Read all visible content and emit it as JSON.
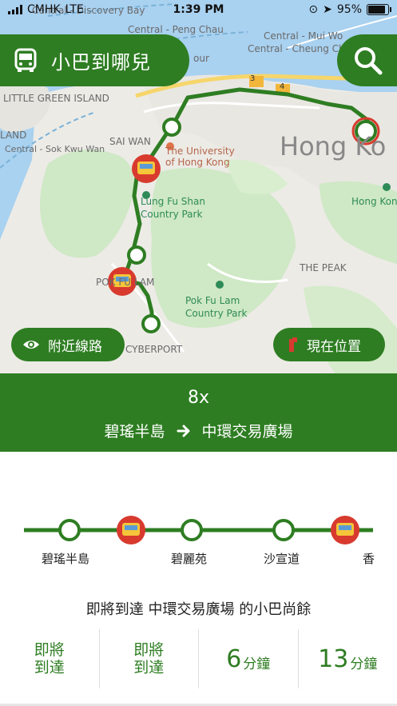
{
  "status_bar": {
    "carrier": "CMHK",
    "network": "LTE",
    "time": "1:39 PM",
    "battery": "95%"
  },
  "app": {
    "title": "小巴到哪兒",
    "accent_color": "#2e7d22",
    "bus_marker_color": "#d83a2e"
  },
  "map": {
    "labels": {
      "discovery_bay": "Central - Discovery Bay",
      "peng_chau": "Central - Peng Chau",
      "mui_wo": "Central - Mui Wo",
      "cheung_chau": "Central - Cheung Ch",
      "sok_kwu_wan": "Central - Sok Kwu Wan",
      "little_green_island": "LITTLE GREEN ISLAND",
      "land": "LAND",
      "sai_wan": "SAI WAN",
      "hku": "The University of Hong Kong",
      "lung_fu_shan": "Lung Fu Shan Country Park",
      "hong_kong_big": "Hong Ko",
      "hong_kong_park": "Hong Kong",
      "the_peak": "THE PEAK",
      "pok_fu_lam_park": "Pok Fu Lam Country Park",
      "pok_fu_lam": "POK FU LAM",
      "cyberport": "CYBERPORT",
      "road_3": "3",
      "road_4": "4",
      "our": "our"
    },
    "nearby_routes_label": "附近線路",
    "current_location_label": "現在位置"
  },
  "route": {
    "number": "8x",
    "from": "碧瑤半島",
    "to": "中環交易廣場"
  },
  "stops": [
    "碧瑤半島",
    "碧麗苑",
    "沙宣道",
    "香"
  ],
  "arrival": {
    "remaining_text": "即將到達 中環交易廣場 的小巴尚餘",
    "etas": [
      {
        "type": "text",
        "line1": "即將",
        "line2": "到達"
      },
      {
        "type": "text",
        "line1": "即將",
        "line2": "到達"
      },
      {
        "type": "time",
        "value": "6",
        "unit": "分鐘"
      },
      {
        "type": "time",
        "value": "13",
        "unit": "分鐘"
      }
    ]
  }
}
